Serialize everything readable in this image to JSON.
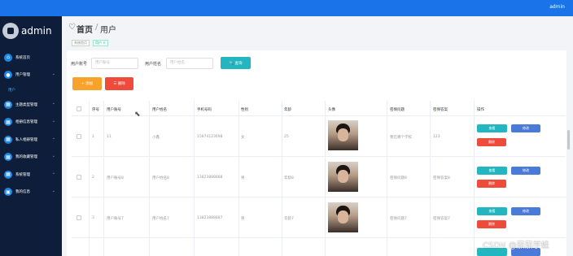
{
  "topbar": {
    "user": "admin"
  },
  "sidebar": {
    "brand": "admin",
    "items": [
      {
        "label": "系统首页",
        "icon": "home-icon"
      },
      {
        "label": "用户管理",
        "icon": "user-icon",
        "chevron": "⌄"
      },
      {
        "label": "主题类型管理",
        "icon": "grid-icon",
        "chevron": "⌄"
      },
      {
        "label": "相册信息管理",
        "icon": "grid-icon",
        "chevron": "⌄"
      },
      {
        "label": "私人相册管理",
        "icon": "grid-icon",
        "chevron": "⌄"
      },
      {
        "label": "我的收藏管理",
        "icon": "grid-icon",
        "chevron": "⌄"
      },
      {
        "label": "系统管理",
        "icon": "grid-icon",
        "chevron": "⌄"
      },
      {
        "label": "我的信息",
        "icon": "info-icon",
        "chevron": "⌄"
      }
    ],
    "sub_item": "用户"
  },
  "breadcrumb": {
    "home": "首页",
    "sep": "/",
    "page": "用户"
  },
  "tags": [
    "系统首页",
    "用户 ×"
  ],
  "search": {
    "account_label": "用户账号",
    "account_placeholder": "用户账号",
    "name_label": "用户姓名",
    "name_placeholder": "用户姓名",
    "search_button": "🔍 查询"
  },
  "toolbar": {
    "add": "+ 添加",
    "delete": "☰ 删除"
  },
  "table": {
    "headers": [
      "序号",
      "用户账号",
      "用户姓名",
      "手机号码",
      "性别",
      "年龄",
      "头像",
      "密保问题",
      "密保答案",
      "操作"
    ],
    "rows": [
      [
        "1",
        "11",
        "小鑫",
        "15874123698",
        "女",
        "25",
        "",
        "我在哪个学校",
        "123"
      ],
      [
        "2",
        "用户账号8",
        "用户姓名8",
        "13823888888",
        "男",
        "年龄8",
        "",
        "密保问题8",
        "密保答案8"
      ],
      [
        "3",
        "用户账号7",
        "用户姓名7",
        "13823888887",
        "男",
        "年龄7",
        "",
        "密保问题7",
        "密保答案7"
      ]
    ],
    "actions": {
      "view": "查看",
      "edit": "修改",
      "delete": "删除"
    }
  },
  "watermark": "CSDN @茄茄学姐"
}
